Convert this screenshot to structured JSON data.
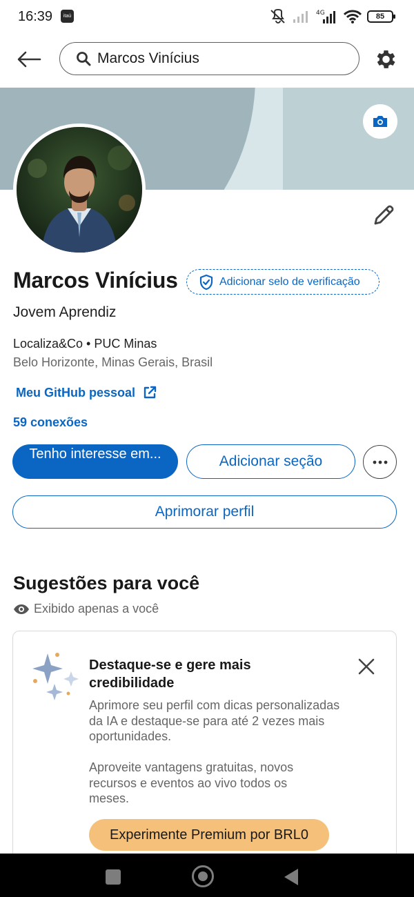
{
  "status_bar": {
    "time": "16:39",
    "app_badge": "itaú",
    "network": "4G",
    "battery": "85"
  },
  "top_bar": {
    "search_value": "Marcos Vinícius",
    "icons": [
      "back-arrow-icon",
      "search-icon",
      "gear-icon"
    ]
  },
  "profile": {
    "name": "Marcos Vinícius",
    "verification_badge": "Adicionar selo de verificação",
    "headline": "Jovem Aprendiz",
    "company": "Localiza&Co • PUC Minas",
    "location": "Belo Horizonte, Minas Gerais, Brasil",
    "link_label": "Meu GitHub pessoal",
    "connections": "59 conexões"
  },
  "actions": {
    "primary": "Tenho interesse em...",
    "add_section": "Adicionar seção",
    "improve_profile": "Aprimorar perfil"
  },
  "suggestions": {
    "title": "Sugestões para você",
    "visibility": "Exibido apenas a você",
    "card": {
      "title": "Destaque-se e gere mais credibilidade",
      "body_1": "Aprimore seu perfil com dicas personalizadas da IA e destaque-se para até 2 vezes mais oportunidades.",
      "body_2": "Aproveite vantagens gratuitas, novos recursos e eventos ao vivo todos os meses.",
      "cta": "Experimente Premium por BRL0"
    }
  },
  "colors": {
    "brand_blue": "#0a66c2",
    "premium_gold": "#f5c17a",
    "banner": "#b9cdd2"
  }
}
